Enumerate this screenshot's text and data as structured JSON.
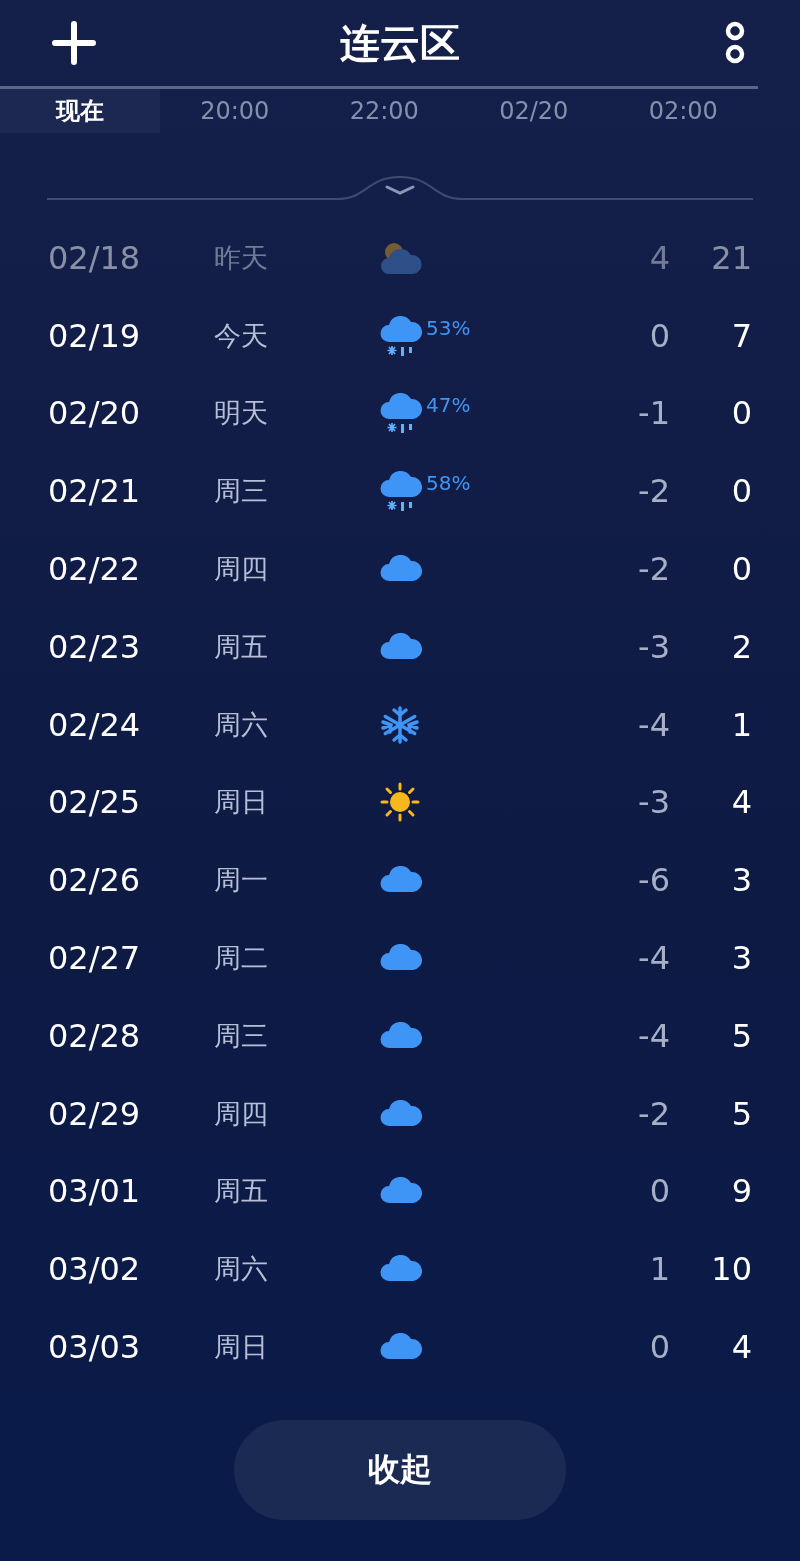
{
  "header": {
    "title": "连云区"
  },
  "hourly": [
    {
      "label": "现在",
      "selected": true
    },
    {
      "label": "20:00",
      "selected": false
    },
    {
      "label": "22:00",
      "selected": false
    },
    {
      "label": "02/20",
      "selected": false
    },
    {
      "label": "02:00",
      "selected": false
    }
  ],
  "days": [
    {
      "date": "02/18",
      "weekday": "昨天",
      "kind": "partly-cloudy",
      "low": "4",
      "high": "21",
      "past": true
    },
    {
      "date": "02/19",
      "weekday": "今天",
      "kind": "sleet",
      "precip": "53%",
      "low": "0",
      "high": "7",
      "past": false
    },
    {
      "date": "02/20",
      "weekday": "明天",
      "kind": "sleet",
      "precip": "47%",
      "low": "-1",
      "high": "0",
      "past": false
    },
    {
      "date": "02/21",
      "weekday": "周三",
      "kind": "sleet",
      "precip": "58%",
      "low": "-2",
      "high": "0",
      "past": false
    },
    {
      "date": "02/22",
      "weekday": "周四",
      "kind": "cloudy",
      "low": "-2",
      "high": "0",
      "past": false
    },
    {
      "date": "02/23",
      "weekday": "周五",
      "kind": "cloudy",
      "low": "-3",
      "high": "2",
      "past": false
    },
    {
      "date": "02/24",
      "weekday": "周六",
      "kind": "snow",
      "low": "-4",
      "high": "1",
      "past": false
    },
    {
      "date": "02/25",
      "weekday": "周日",
      "kind": "sunny",
      "low": "-3",
      "high": "4",
      "past": false
    },
    {
      "date": "02/26",
      "weekday": "周一",
      "kind": "cloudy",
      "low": "-6",
      "high": "3",
      "past": false
    },
    {
      "date": "02/27",
      "weekday": "周二",
      "kind": "cloudy",
      "low": "-4",
      "high": "3",
      "past": false
    },
    {
      "date": "02/28",
      "weekday": "周三",
      "kind": "cloudy",
      "low": "-4",
      "high": "5",
      "past": false
    },
    {
      "date": "02/29",
      "weekday": "周四",
      "kind": "cloudy",
      "low": "-2",
      "high": "5",
      "past": false
    },
    {
      "date": "03/01",
      "weekday": "周五",
      "kind": "cloudy",
      "low": "0",
      "high": "9",
      "past": false
    },
    {
      "date": "03/02",
      "weekday": "周六",
      "kind": "cloudy",
      "low": "1",
      "high": "10",
      "past": false
    },
    {
      "date": "03/03",
      "weekday": "周日",
      "kind": "cloudy",
      "low": "0",
      "high": "4",
      "past": false
    }
  ],
  "collapse_button": "收起"
}
